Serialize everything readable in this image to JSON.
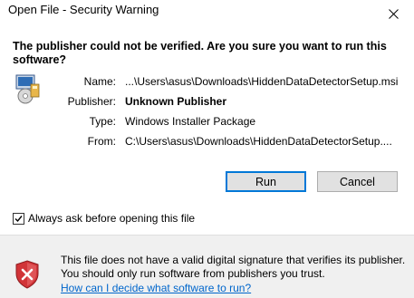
{
  "window": {
    "title": "Open File - Security Warning",
    "close_icon": "close-icon"
  },
  "headline": "The publisher could not be verified.  Are you sure you want to run this software?",
  "details": {
    "icon": "windows-installer-icon",
    "rows": [
      {
        "label": "Name:",
        "value": "...\\Users\\asus\\Downloads\\HiddenDataDetectorSetup.msi",
        "bold": false
      },
      {
        "label": "Publisher:",
        "value": "Unknown Publisher",
        "bold": true
      },
      {
        "label": "Type:",
        "value": "Windows Installer Package",
        "bold": false
      },
      {
        "label": "From:",
        "value": "C:\\Users\\asus\\Downloads\\HiddenDataDetectorSetup....",
        "bold": false
      }
    ]
  },
  "buttons": {
    "run_label": "Run",
    "cancel_label": "Cancel"
  },
  "checkbox": {
    "label": "Always ask before opening this file",
    "checked": true
  },
  "footer": {
    "icon": "security-shield-icon",
    "message": "This file does not have a valid digital signature that verifies its publisher.  You should only run software from publishers you trust.",
    "link_text": "How can I decide what software to run?"
  },
  "colors": {
    "link": "#0066cc",
    "footer_bg": "#f0f0f0",
    "default_button_border": "#0078d7",
    "shield_red": "#d13438"
  }
}
